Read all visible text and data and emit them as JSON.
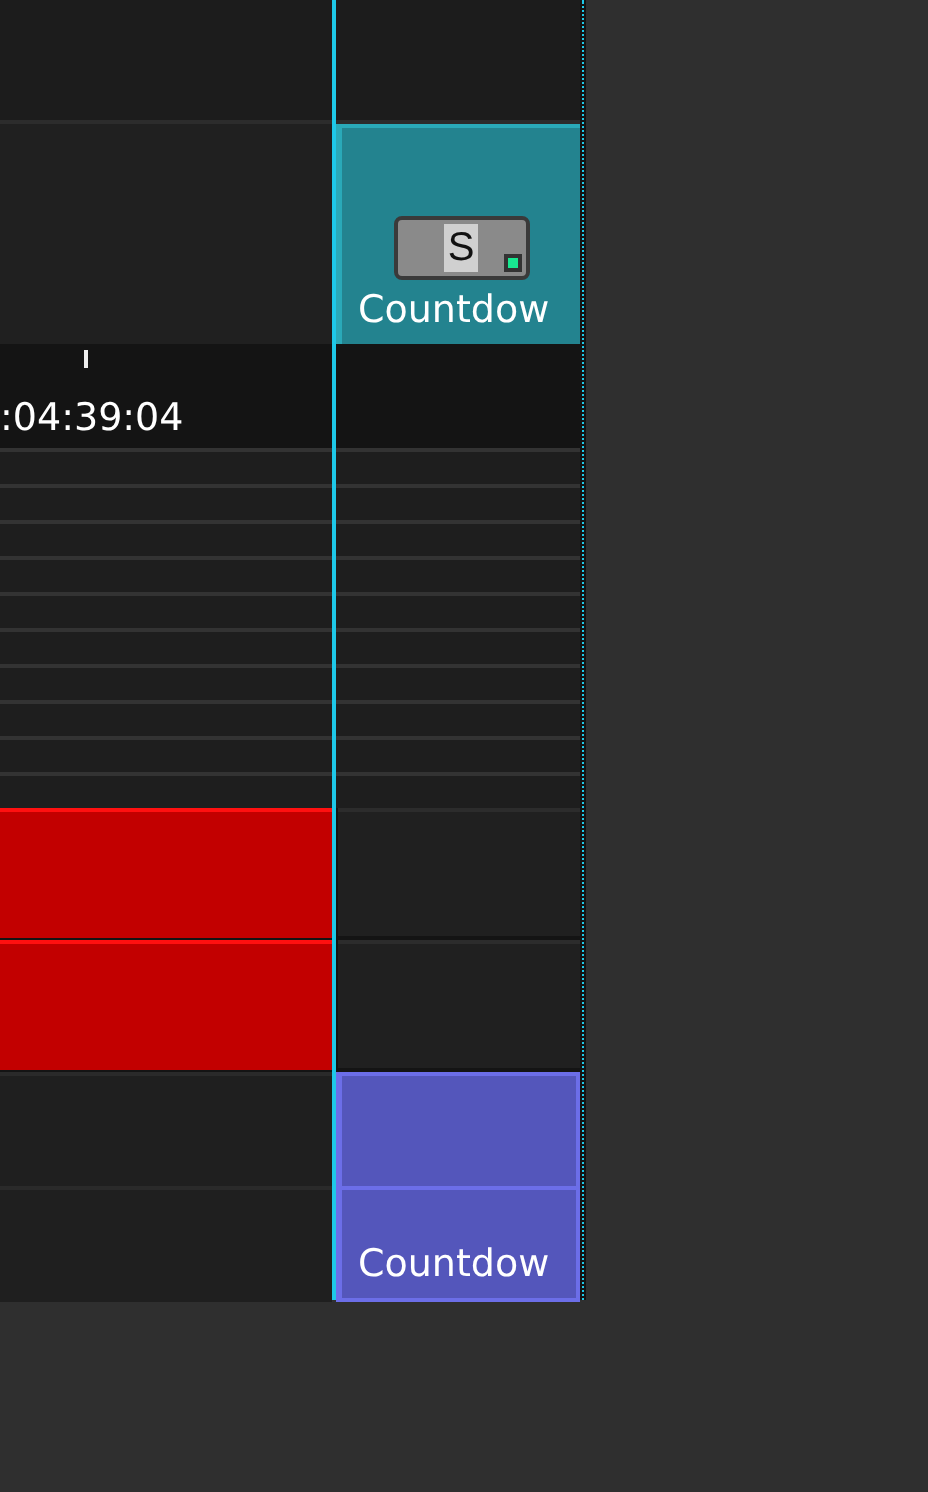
{
  "tracks": [
    {
      "kind": "blank"
    },
    {
      "kind": "cue",
      "clip": {
        "label": "Countdow",
        "color": "#23838f",
        "button": "S",
        "active": true
      }
    },
    {
      "kind": "ruler",
      "timecode": ":04:39:04"
    },
    {
      "kind": "lanes"
    },
    {
      "kind": "block",
      "color": "#c20000"
    },
    {
      "kind": "block",
      "color": "#c20000"
    },
    {
      "kind": "pair",
      "clip": {
        "label": "Countdow",
        "color": "#5456bb"
      }
    }
  ]
}
